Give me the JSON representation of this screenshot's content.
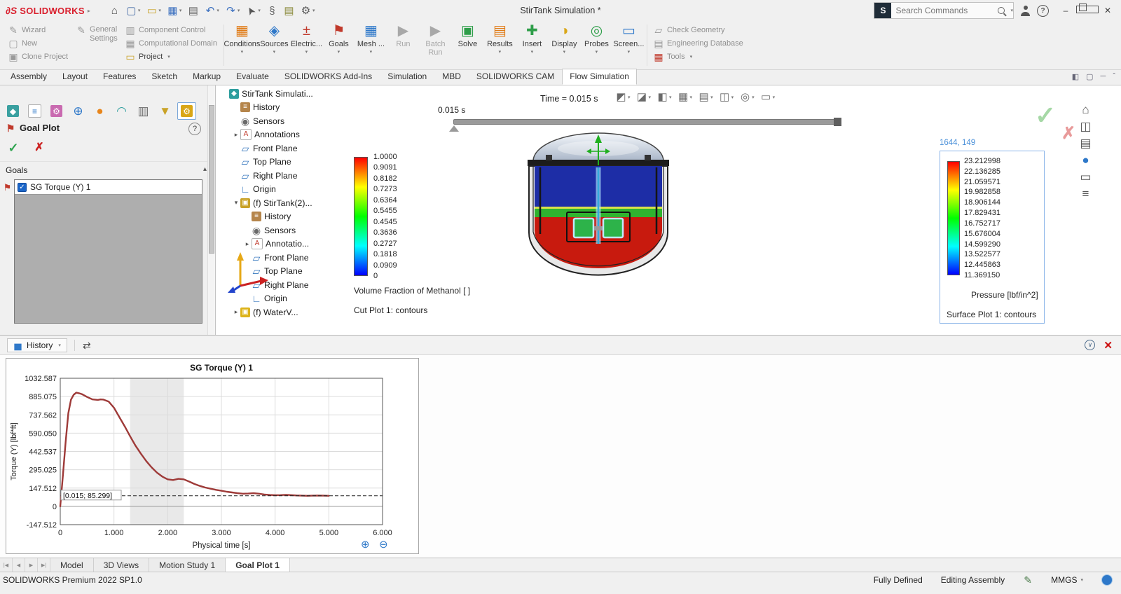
{
  "titlebar": {
    "logo_text": "SOLIDWORKS",
    "title": "StirTank Simulation *",
    "search_placeholder": "Search Commands",
    "icons": [
      {
        "name": "home-icon"
      },
      {
        "name": "new-doc-icon",
        "caret": true
      },
      {
        "name": "open-icon",
        "caret": true
      },
      {
        "name": "save-icon",
        "caret": true
      },
      {
        "name": "print-icon"
      },
      {
        "name": "undo-icon",
        "caret": true
      },
      {
        "name": "redo-icon",
        "caret": true
      },
      {
        "name": "select-arrow-icon",
        "caret": true
      },
      {
        "name": "attachment-icon"
      },
      {
        "name": "sheet-icon"
      },
      {
        "name": "options-gear-icon",
        "caret": true
      }
    ]
  },
  "ribbon": {
    "left_col1": [
      {
        "label": "Wizard",
        "icon": "wizard-icon"
      },
      {
        "label": "New",
        "icon": "new-project-icon"
      },
      {
        "label": "Clone Project",
        "icon": "clone-project-icon"
      }
    ],
    "left_col2": [
      {
        "label": "General Settings",
        "icon": "general-settings-icon"
      }
    ],
    "left_col3": [
      {
        "label": "Component Control",
        "icon": "component-control-icon"
      },
      {
        "label": "Computational Domain",
        "icon": "computational-domain-icon"
      },
      {
        "label": "Project",
        "icon": "project-folder-icon",
        "caret": true,
        "dark": true
      }
    ],
    "big_buttons": [
      {
        "label": "Conditions",
        "icon": "conditions-icon",
        "caret": true
      },
      {
        "label": "Sources",
        "icon": "sources-icon",
        "caret": true
      },
      {
        "label": "Electric...",
        "icon": "electrical-icon",
        "caret": true
      },
      {
        "label": "Goals",
        "icon": "goals-icon",
        "caret": true
      },
      {
        "label": "Mesh ...",
        "icon": "mesh-icon",
        "caret": true
      },
      {
        "label": "Run",
        "icon": "run-icon",
        "disabled": true
      },
      {
        "label": "Batch Run",
        "icon": "batch-run-icon",
        "disabled": true
      },
      {
        "label": "Solve",
        "icon": "solve-icon"
      },
      {
        "label": "Results",
        "icon": "results-icon",
        "caret": true
      },
      {
        "label": "Insert",
        "icon": "insert-icon",
        "caret": true
      },
      {
        "label": "Display",
        "icon": "display-icon",
        "caret": true
      },
      {
        "label": "Probes",
        "icon": "probes-icon",
        "caret": true
      },
      {
        "label": "Screen...",
        "icon": "screen-icon",
        "caret": true
      }
    ],
    "right_items": [
      {
        "label": "Check Geometry",
        "icon": "check-geometry-icon"
      },
      {
        "label": "Engineering Database",
        "icon": "engineering-database-icon"
      },
      {
        "label": "Tools",
        "icon": "tools-icon",
        "caret": true
      }
    ]
  },
  "command_tabs": {
    "items": [
      {
        "label": "Assembly"
      },
      {
        "label": "Layout"
      },
      {
        "label": "Features"
      },
      {
        "label": "Sketch"
      },
      {
        "label": "Markup"
      },
      {
        "label": "Evaluate"
      },
      {
        "label": "SOLIDWORKS Add-Ins"
      },
      {
        "label": "Simulation"
      },
      {
        "label": "MBD"
      },
      {
        "label": "SOLIDWORKS CAM"
      },
      {
        "label": "Flow Simulation",
        "active": true
      }
    ],
    "right_icons": [
      {
        "name": "split-view-icon",
        "glyph": "◧"
      },
      {
        "name": "pane-icon",
        "glyph": "▢"
      },
      {
        "name": "minimize-ribbon-icon",
        "glyph": "─"
      },
      {
        "name": "expand-icon",
        "glyph": "ˆ"
      }
    ]
  },
  "manager": {
    "title": "Goal Plot",
    "help_label": "?",
    "goals_section": "Goals",
    "goal_item": {
      "label": "SG Torque (Y) 1",
      "checked": true
    },
    "tabs": [
      {
        "name": "propertymanager-tab-icon"
      },
      {
        "name": "featuremanager-tab-icon"
      },
      {
        "name": "configurationmanager-tab-icon"
      },
      {
        "name": "dimxpertmanager-tab-icon"
      },
      {
        "name": "displaymanager-tab-icon"
      },
      {
        "name": "cam-tab-icon"
      },
      {
        "name": "column-tab-icon"
      },
      {
        "name": "filter-tab-icon"
      },
      {
        "name": "flowsim-tab-icon",
        "active": true
      }
    ]
  },
  "tree": {
    "items": [
      {
        "label": "StirTank Simulati...",
        "icon": "flow-simulation-icon",
        "indent": 0
      },
      {
        "label": "History",
        "icon": "history-icon",
        "indent": 1
      },
      {
        "label": "Sensors",
        "icon": "sensors-icon",
        "indent": 1
      },
      {
        "label": "Annotations",
        "icon": "annotations-icon",
        "indent": 1,
        "arrow": "▸"
      },
      {
        "label": "Front Plane",
        "icon": "plane-icon",
        "indent": 1
      },
      {
        "label": "Top Plane",
        "icon": "plane-icon",
        "indent": 1
      },
      {
        "label": "Right Plane",
        "icon": "plane-icon",
        "indent": 1
      },
      {
        "label": "Origin",
        "icon": "origin-icon",
        "indent": 1
      },
      {
        "label": "(f) StirTank(2)...",
        "icon": "assembly-icon",
        "indent": 1,
        "arrow": "▾"
      },
      {
        "label": "History",
        "icon": "history-icon",
        "indent": 2
      },
      {
        "label": "Sensors",
        "icon": "sensors-icon",
        "indent": 2
      },
      {
        "label": "Annotatio...",
        "icon": "annotations-icon",
        "indent": 2,
        "arrow": "▸"
      },
      {
        "label": "Front Plane",
        "icon": "plane-icon",
        "indent": 2
      },
      {
        "label": "Top Plane",
        "icon": "plane-icon",
        "indent": 2
      },
      {
        "label": "Right Plane",
        "icon": "plane-icon",
        "indent": 2
      },
      {
        "label": "Origin",
        "icon": "origin-icon",
        "indent": 2
      },
      {
        "label": "(f) WaterV...",
        "icon": "part-icon",
        "indent": 1,
        "arrow": "▸"
      }
    ]
  },
  "viewport": {
    "time_readout": "Time = 0.015 s",
    "slider_time_label": "0.015 s",
    "top_toolbar": [
      {
        "name": "lighting-icon"
      },
      {
        "name": "section-view-icon"
      },
      {
        "name": "appearance-icon"
      },
      {
        "name": "plot-settings-icon"
      },
      {
        "name": "mesh-display-icon"
      },
      {
        "name": "orientation-icon"
      },
      {
        "name": "camera-icon"
      },
      {
        "name": "monitor-icon"
      }
    ],
    "right_toolbar": [
      {
        "name": "view-home-icon"
      },
      {
        "name": "view-cube-icon"
      },
      {
        "name": "view-stack-icon"
      },
      {
        "name": "render-sphere-icon"
      },
      {
        "name": "display-screen-icon"
      },
      {
        "name": "tree-display-icon"
      }
    ],
    "legend_gradient": [
      "#ff0000",
      "#ffff00",
      "#00ff00",
      "#00ffff",
      "#0000ff"
    ],
    "left_legend": {
      "values": [
        "1.0000",
        "0.9091",
        "0.8182",
        "0.7273",
        "0.6364",
        "0.5455",
        "0.4545",
        "0.3636",
        "0.2727",
        "0.1818",
        "0.0909",
        "0"
      ],
      "title": "Volume Fraction of Methanol [ ]",
      "subtitle": "Cut Plot 1: contours"
    },
    "right_legend": {
      "callout": "1644, 149",
      "values": [
        "23.212998",
        "22.136285",
        "21.059571",
        "19.982858",
        "18.906144",
        "17.829431",
        "16.752717",
        "15.676004",
        "14.599290",
        "13.522577",
        "12.445863",
        "11.369150"
      ],
      "title": "Pressure [lbf/in^2]",
      "subtitle": "Surface Plot 1: contours"
    }
  },
  "bottom": {
    "history_label": "History",
    "nav_buttons": [
      {
        "name": "first-tab-button",
        "glyph": "|◀"
      },
      {
        "name": "prev-tab-button",
        "glyph": "◀"
      },
      {
        "name": "next-tab-button",
        "glyph": "▶"
      },
      {
        "name": "last-tab-button",
        "glyph": "▶|"
      }
    ],
    "tabs": [
      {
        "label": "Model"
      },
      {
        "label": "3D Views"
      },
      {
        "label": "Motion Study 1"
      },
      {
        "label": "Goal Plot 1",
        "active": true
      }
    ]
  },
  "chart_data": {
    "type": "line",
    "title": "SG Torque (Y) 1",
    "xlabel": "Physical time [s]",
    "ylabel": "Torque (Y) [lbf*ft]",
    "x_range": [
      0,
      6
    ],
    "x_ticks": [
      "0",
      "1.000",
      "2.000",
      "3.000",
      "4.000",
      "5.000",
      "6.000"
    ],
    "y_range": [
      -147.512,
      1032.587
    ],
    "y_ticks": [
      "1032.587",
      "885.075",
      "737.562",
      "590.050",
      "442.537",
      "295.025",
      "147.512",
      "0",
      "-147.512"
    ],
    "grid": true,
    "band_x": [
      1.3,
      2.3
    ],
    "series": [
      {
        "name": "SG Torque (Y) 1",
        "color": "#9e3a38",
        "points": [
          [
            0,
            0
          ],
          [
            0.05,
            250
          ],
          [
            0.1,
            520
          ],
          [
            0.15,
            750
          ],
          [
            0.2,
            860
          ],
          [
            0.25,
            900
          ],
          [
            0.3,
            917
          ],
          [
            0.35,
            912
          ],
          [
            0.4,
            905
          ],
          [
            0.5,
            882
          ],
          [
            0.6,
            862
          ],
          [
            0.7,
            858
          ],
          [
            0.75,
            862
          ],
          [
            0.8,
            861
          ],
          [
            0.9,
            845
          ],
          [
            1,
            795
          ],
          [
            1.1,
            720
          ],
          [
            1.2,
            645
          ],
          [
            1.3,
            565
          ],
          [
            1.4,
            490
          ],
          [
            1.5,
            425
          ],
          [
            1.6,
            365
          ],
          [
            1.7,
            315
          ],
          [
            1.8,
            272
          ],
          [
            1.9,
            240
          ],
          [
            2,
            218
          ],
          [
            2.1,
            212
          ],
          [
            2.2,
            222
          ],
          [
            2.3,
            218
          ],
          [
            2.4,
            200
          ],
          [
            2.5,
            180
          ],
          [
            2.6,
            165
          ],
          [
            2.7,
            152
          ],
          [
            2.8,
            142
          ],
          [
            2.9,
            133
          ],
          [
            3,
            126
          ],
          [
            3.1,
            118
          ],
          [
            3.2,
            112
          ],
          [
            3.3,
            106
          ],
          [
            3.4,
            102
          ],
          [
            3.5,
            103
          ],
          [
            3.6,
            106
          ],
          [
            3.7,
            102
          ],
          [
            3.8,
            96
          ],
          [
            3.9,
            92
          ],
          [
            4,
            90
          ],
          [
            4.1,
            91
          ],
          [
            4.2,
            93
          ],
          [
            4.3,
            91
          ],
          [
            4.4,
            88
          ],
          [
            4.5,
            86
          ],
          [
            4.6,
            85
          ],
          [
            4.7,
            86
          ],
          [
            4.8,
            87
          ],
          [
            4.9,
            86
          ],
          [
            5,
            85
          ]
        ]
      }
    ],
    "reference_line": {
      "y": 85.299,
      "label": "[0.015; 85.299]",
      "style": "dashed"
    }
  },
  "statusbar": {
    "left": "SOLIDWORKS Premium 2022 SP1.0",
    "items": [
      {
        "label": "Fully Defined"
      },
      {
        "label": "Editing Assembly"
      },
      {
        "icon": "edit-pencil-icon"
      },
      {
        "label": "MMGS",
        "caret": true
      },
      {
        "icon": "globe-icon"
      }
    ]
  }
}
